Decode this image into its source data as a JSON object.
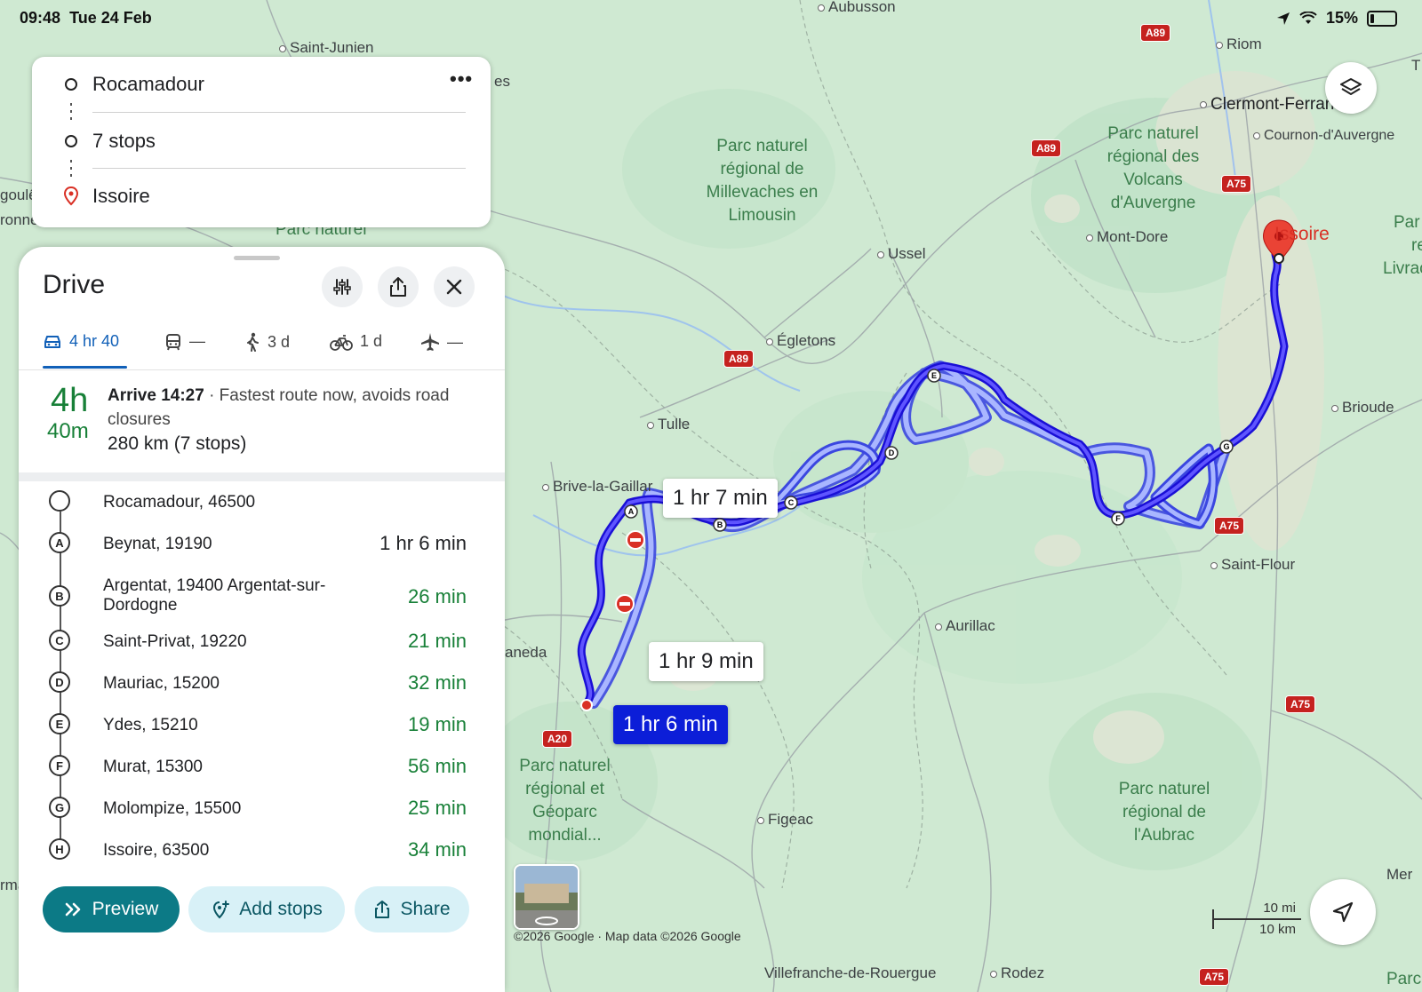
{
  "status_bar": {
    "time": "09:48",
    "date": "Tue 24 Feb",
    "battery": "15%"
  },
  "route_card": {
    "origin": "Rocamadour",
    "stops": "7 stops",
    "destination": "Issoire",
    "more_label": "•••"
  },
  "panel": {
    "title": "Drive",
    "modes": [
      {
        "icon": "car-icon",
        "label": "4 hr 40"
      },
      {
        "icon": "transit-icon",
        "label": "—"
      },
      {
        "icon": "walk-icon",
        "label": "3 d"
      },
      {
        "icon": "bike-icon",
        "label": "1 d"
      },
      {
        "icon": "flight-icon",
        "label": "—"
      }
    ],
    "summary": {
      "duration_hours": "4h",
      "duration_minutes": "40m",
      "arrive": "Arrive 14:27",
      "description": " · Fastest route now, avoids road closures",
      "distance": "280 km (7 stops)"
    },
    "stops": [
      {
        "marker": "",
        "name": "Rocamadour, 46500",
        "time": ""
      },
      {
        "marker": "A",
        "name": "Beynat, 19190",
        "time": "1 hr 6 min"
      },
      {
        "marker": "B",
        "name": "Argentat, 19400 Argentat-sur-Dordogne",
        "time": "26 min"
      },
      {
        "marker": "C",
        "name": "Saint-Privat, 19220",
        "time": "21 min"
      },
      {
        "marker": "D",
        "name": "Mauriac, 15200",
        "time": "32 min"
      },
      {
        "marker": "E",
        "name": "Ydes, 15210",
        "time": "19 min"
      },
      {
        "marker": "F",
        "name": "Murat, 15300",
        "time": "56 min"
      },
      {
        "marker": "G",
        "name": "Molompize, 15500",
        "time": "25 min"
      },
      {
        "marker": "H",
        "name": "Issoire, 63500",
        "time": "34 min"
      }
    ],
    "actions": {
      "preview": "Preview",
      "add_stops": "Add stops",
      "share": "Share"
    }
  },
  "map": {
    "towns": [
      "Aubusson",
      "Saint-Junien",
      "Riom",
      "Clermont-Ferrand",
      "Cournon-d'Auvergne",
      "Mont-Dore",
      "Ussel",
      "Égletons",
      "Tulle",
      "Brive-la-Gaillar",
      "Brioude",
      "Saint-Flour",
      "Aurillac",
      "Figeac",
      "Villefranche-de-Rouergue",
      "Rodez",
      "Issoire"
    ],
    "parks": [
      "Parc naturel régional de Millevaches en Limousin",
      "Parc naturel régional des Volcans d'Auvergne",
      "Parc naturel régional et Géoparc mondial...",
      "Parc naturel régional de l'Aubrac"
    ],
    "edge_labels": [
      "es",
      "goulê",
      "ronne",
      "Parc naturel",
      "aneda",
      "rma",
      "Par",
      "re",
      "Livrac",
      "Mer",
      "Parc n",
      "T"
    ],
    "roads": [
      "A89",
      "A89",
      "A89",
      "A75",
      "A75",
      "A75",
      "A75",
      "A20"
    ],
    "callouts": {
      "alt1": "1 hr 7 min",
      "alt2": "1 hr 9 min",
      "selected": "1 hr 6 min"
    },
    "attribution": "©2026 Google · Map data ©2026 Google",
    "scale_mi": "10 mi",
    "scale_km": "10 km",
    "route_color": "#1a0fd6",
    "alt_route_color": "#8fa4ff"
  }
}
